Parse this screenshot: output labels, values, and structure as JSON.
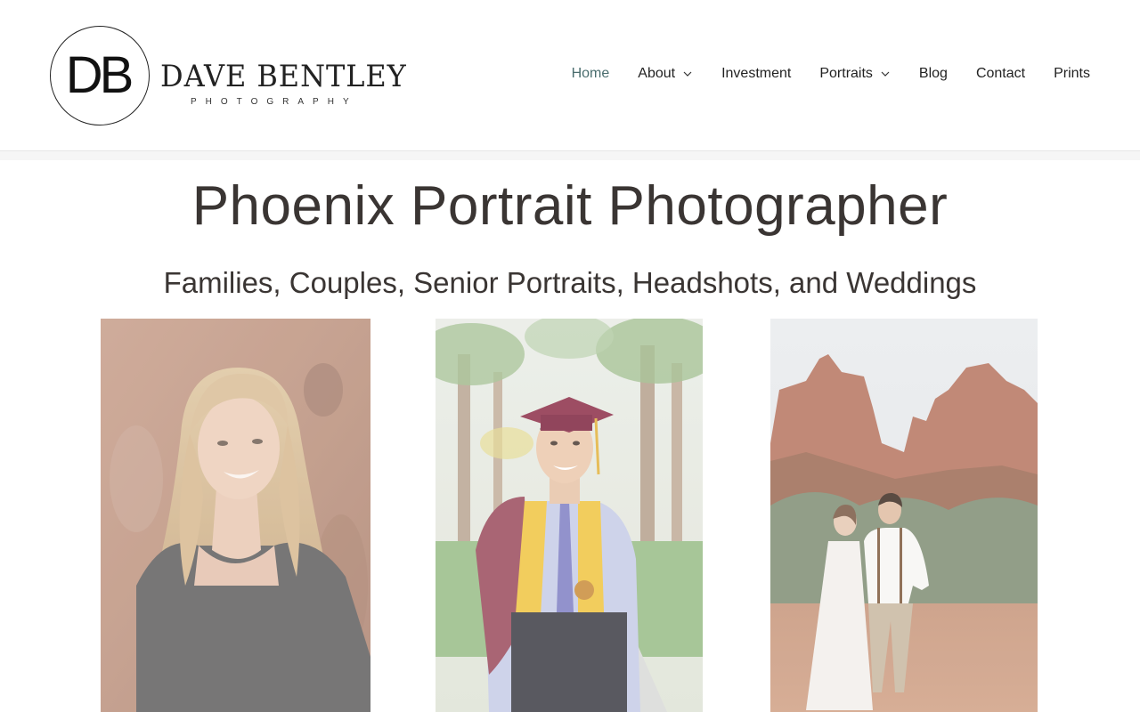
{
  "logo": {
    "monogram": "DB",
    "name": "DAVE BENTLEY",
    "tagline": "PHOTOGRAPHY"
  },
  "nav": {
    "items": [
      {
        "label": "Home",
        "active": true,
        "dropdown": false
      },
      {
        "label": "About",
        "active": false,
        "dropdown": true
      },
      {
        "label": "Investment",
        "active": false,
        "dropdown": false
      },
      {
        "label": "Portraits",
        "active": false,
        "dropdown": true
      },
      {
        "label": "Blog",
        "active": false,
        "dropdown": false
      },
      {
        "label": "Contact",
        "active": false,
        "dropdown": false
      },
      {
        "label": "Prints",
        "active": false,
        "dropdown": false
      }
    ],
    "active_color": "#4a6d6e",
    "dropdown_icon": "chevron-down-icon"
  },
  "hero": {
    "title": "Phoenix Portrait Photographer",
    "subtitle": "Families, Couples, Senior Portraits, Headshots, and Weddings"
  },
  "gallery": {
    "photos": [
      {
        "subject": "senior-portrait-woman"
      },
      {
        "subject": "graduate-portrait"
      },
      {
        "subject": "couple-red-rocks"
      }
    ]
  }
}
